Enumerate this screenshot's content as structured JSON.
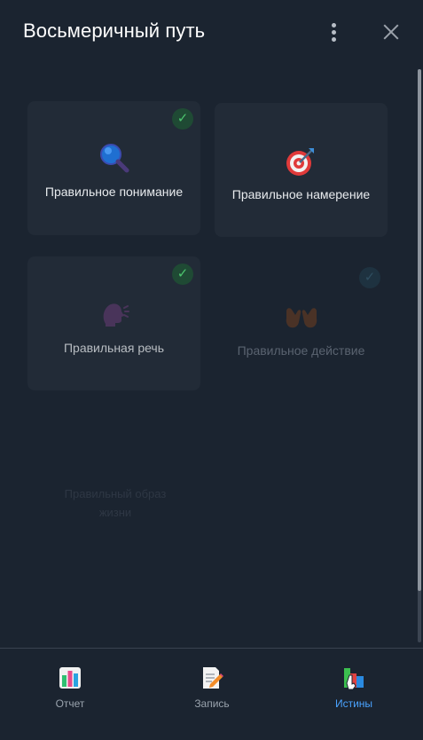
{
  "header": {
    "title": "Восьмеричный путь"
  },
  "cards": [
    {
      "label": "Правильное понимание",
      "checked": true,
      "icon": "magnifier-icon"
    },
    {
      "label": "Правильное намерение",
      "checked": false,
      "icon": "target-icon"
    },
    {
      "label": "Правильная речь",
      "checked": true,
      "icon": "speaking-head-icon"
    },
    {
      "label": "Правильное действие",
      "checked": true,
      "icon": "open-hands-icon"
    }
  ],
  "ghost": {
    "line1": "Правильный образ",
    "line2": "жизни"
  },
  "footer": {
    "tabs": [
      {
        "label": "Отчет",
        "icon": "chart-icon"
      },
      {
        "label": "Запись",
        "icon": "memo-icon"
      },
      {
        "label": "Истины",
        "icon": "books-icon",
        "active": true
      }
    ]
  },
  "colors": {
    "accent": "#4aa3ff",
    "check": "#4cc46e",
    "background": "#1b2430",
    "card": "#222b37"
  }
}
